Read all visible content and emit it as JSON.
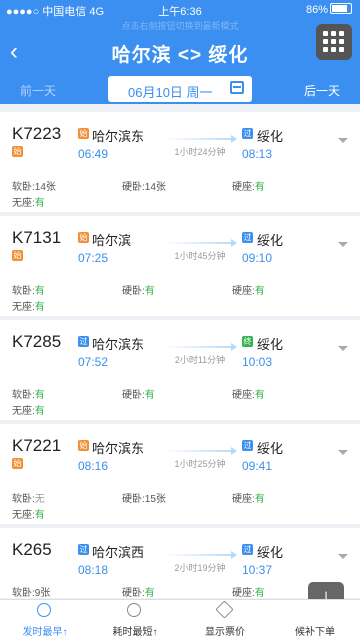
{
  "status": {
    "carrier": "●●●●○ 中国电信 4G",
    "time": "上午6:36",
    "battery": "86%"
  },
  "header": {
    "hint": "点击右侧按钮切换到最新模式",
    "title": "哈尔滨 <> 绥化",
    "back": "‹",
    "prev_day": "前一天",
    "next_day": "后一天",
    "date": "06月10日 周一"
  },
  "trains": [
    {
      "no": "K7223",
      "origin_tag": "始",
      "from_tag": "始",
      "from": "哈尔滨东",
      "dep": "06:49",
      "dur": "1小时24分钟",
      "to_tag": "过",
      "to": "绥化",
      "arr": "08:13",
      "seats": {
        "soft": "14张",
        "hard": "14张",
        "hardseat": "有",
        "noseat": "有"
      }
    },
    {
      "no": "K7131",
      "origin_tag": "始",
      "from_tag": "始",
      "from": "哈尔滨",
      "dep": "07:25",
      "dur": "1小时45分钟",
      "to_tag": "过",
      "to": "绥化",
      "arr": "09:10",
      "seats": {
        "soft": "有",
        "hard": "有",
        "hardseat": "有",
        "noseat": "有"
      }
    },
    {
      "no": "K7285",
      "origin_tag": "",
      "from_tag": "过",
      "from": "哈尔滨东",
      "dep": "07:52",
      "dur": "2小时11分钟",
      "to_tag": "终",
      "to": "绥化",
      "arr": "10:03",
      "seats": {
        "soft": "有",
        "hard": "有",
        "hardseat": "有",
        "noseat": "有"
      }
    },
    {
      "no": "K7221",
      "origin_tag": "始",
      "from_tag": "始",
      "from": "哈尔滨东",
      "dep": "08:16",
      "dur": "1小时25分钟",
      "to_tag": "过",
      "to": "绥化",
      "arr": "09:41",
      "seats": {
        "soft": "无",
        "hard": "15张",
        "hardseat": "有",
        "noseat": "有"
      }
    },
    {
      "no": "K265",
      "origin_tag": "",
      "from_tag": "过",
      "from": "哈尔滨西",
      "dep": "08:18",
      "dur": "2小时19分钟",
      "to_tag": "过",
      "to": "绥化",
      "arr": "10:37",
      "seats": {
        "soft": "9张",
        "hard": "有",
        "hardseat": "有",
        "noseat": ""
      }
    }
  ],
  "seat_labels": {
    "soft": "软卧:",
    "hard": "硬卧:",
    "hardseat": "硬座:",
    "noseat": "无座:"
  },
  "tabs": [
    {
      "label": "发时最早↑",
      "icon": "clock-icon"
    },
    {
      "label": "耗时最短↑",
      "icon": "stopwatch-icon"
    },
    {
      "label": "显示票价",
      "icon": "price-tag-icon"
    },
    {
      "label": "候补下单",
      "icon": "download-icon"
    }
  ],
  "colors": {
    "brand": "#3a8ff0",
    "available": "#37b24d",
    "origin_tag": "#f0913a"
  }
}
